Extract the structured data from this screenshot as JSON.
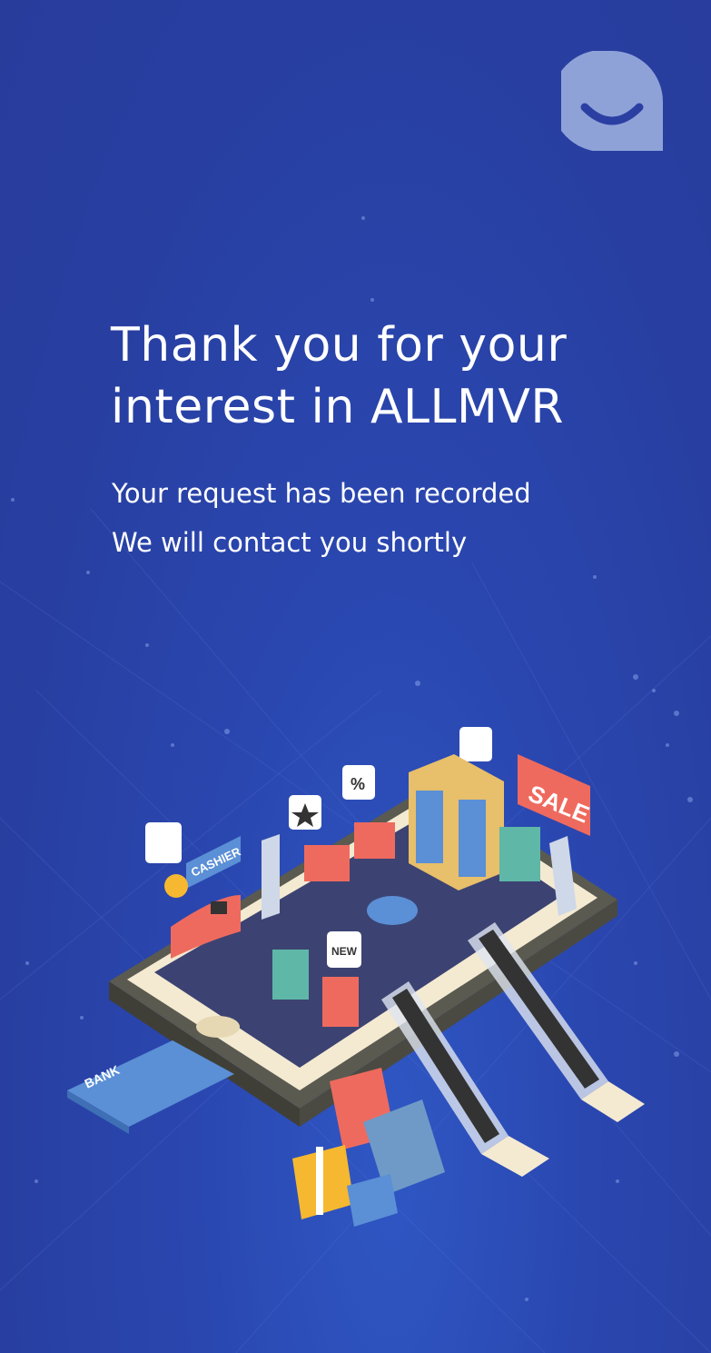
{
  "colors": {
    "background": "#2a44a8",
    "logo": "#8fa2d8",
    "text": "#ffffff",
    "accent_red": "#ef6a5e",
    "card_blue": "#5b8fd6"
  },
  "logo": {
    "icon": "smile-chat-bubble-icon"
  },
  "heading": {
    "line1": "Thank you for your",
    "line2": "interest in ALLMVR"
  },
  "message": {
    "line1": "Your request has been recorded",
    "line2": "We will contact you shortly"
  },
  "illustration": {
    "cashier_sign": "CASHIER",
    "sale_sign": "SALE",
    "new_tag": "NEW",
    "bank_card": "BANK",
    "percent_tag": "%"
  }
}
